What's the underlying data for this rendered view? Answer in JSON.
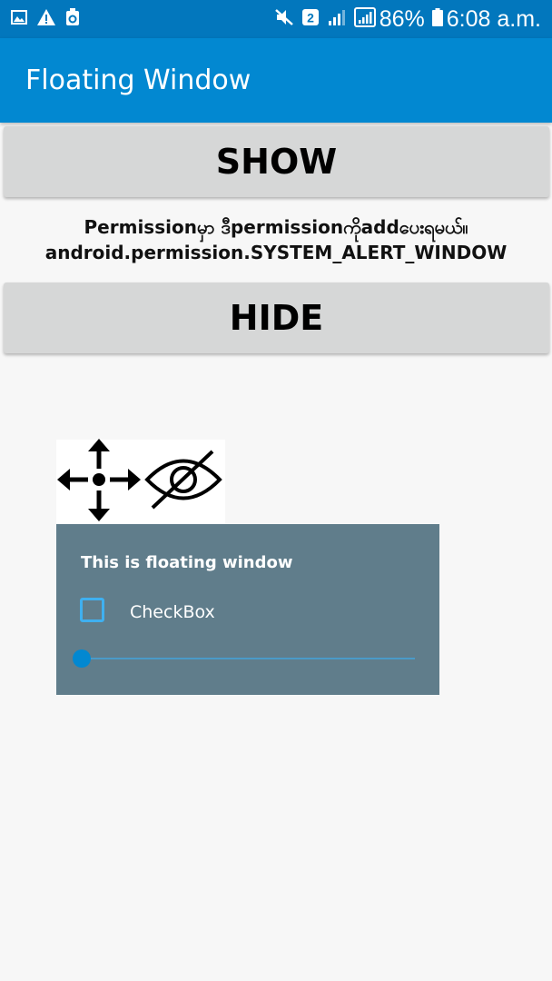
{
  "status_bar": {
    "battery_percent": "86%",
    "time": "6:08 a.m.",
    "sim_badge": "2",
    "left_icons": [
      "image-icon",
      "warning-icon",
      "recycle-icon"
    ],
    "right_icons": [
      "mute-icon",
      "sim-icon",
      "signal-icon",
      "signal-icon",
      "battery-icon"
    ]
  },
  "app_bar": {
    "title": "Floating Window"
  },
  "buttons": {
    "show_label": "SHOW",
    "hide_label": "HIDE"
  },
  "permission": {
    "line1": "Permissionမှာ ဒီpermissionကိုaddပေးရမယ်။",
    "line2": "android.permission.SYSTEM_ALERT_WINDOW"
  },
  "floating_window": {
    "toolbar_icons": [
      "move-icon",
      "visibility-off-icon"
    ],
    "title": "This is floating window",
    "checkbox_label": "CheckBox",
    "checkbox_checked": false,
    "seekbar_level": 0
  },
  "colors": {
    "status_bar": "#0277bd",
    "app_bar": "#0288d1",
    "panel": "#607d8b",
    "accent": "#3fb0f0"
  }
}
